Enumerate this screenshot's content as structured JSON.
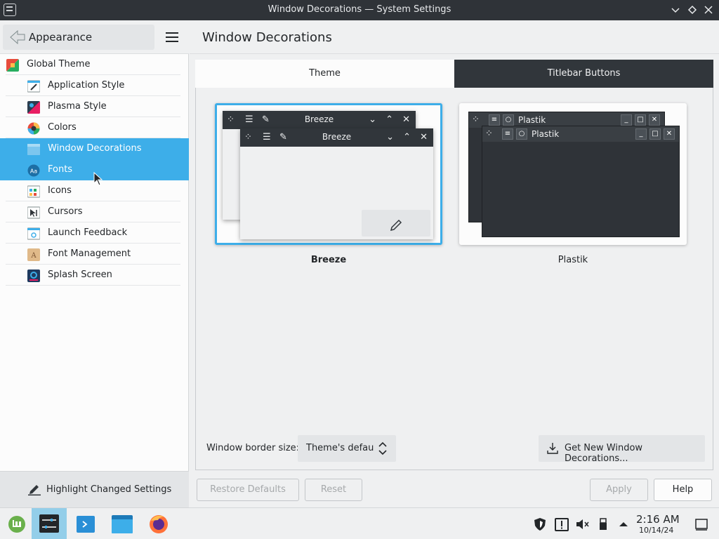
{
  "window": {
    "title": "Window Decorations — System Settings"
  },
  "sidebar": {
    "back_label": "Appearance",
    "items": [
      {
        "label": "Global Theme",
        "icon": "global-theme-icon"
      },
      {
        "label": "Application Style",
        "icon": "application-style-icon"
      },
      {
        "label": "Plasma Style",
        "icon": "plasma-style-icon"
      },
      {
        "label": "Colors",
        "icon": "colors-icon"
      },
      {
        "label": "Window Decorations",
        "icon": "window-decorations-icon",
        "selected": true
      },
      {
        "label": "Fonts",
        "icon": "fonts-icon"
      },
      {
        "label": "Icons",
        "icon": "icons-icon"
      },
      {
        "label": "Cursors",
        "icon": "cursors-icon"
      },
      {
        "label": "Launch Feedback",
        "icon": "launch-feedback-icon"
      },
      {
        "label": "Font Management",
        "icon": "font-management-icon"
      },
      {
        "label": "Splash Screen",
        "icon": "splash-screen-icon"
      }
    ],
    "footer_label": "Highlight Changed Settings"
  },
  "main": {
    "title": "Window Decorations",
    "tabs": [
      {
        "label": "Theme",
        "active": true
      },
      {
        "label": "Titlebar Buttons",
        "active": false
      }
    ],
    "decorations": [
      {
        "name": "Breeze",
        "selected": true,
        "preview_title": "Breeze"
      },
      {
        "name": "Plastik",
        "selected": false,
        "preview_title": "Plastik"
      }
    ],
    "border_size_label": "Window border size:",
    "border_size_value": "Theme's defau",
    "get_new_label": "Get New Window Decorations..."
  },
  "buttons": {
    "restore_defaults": "Restore Defaults",
    "reset": "Reset",
    "apply": "Apply",
    "help": "Help"
  },
  "taskbar": {
    "time": "2:16 AM",
    "date": "10/14/24"
  },
  "colors": {
    "accent": "#3daee9",
    "titlebar": "#2f3338",
    "taskbar_active": "#93cee9"
  }
}
